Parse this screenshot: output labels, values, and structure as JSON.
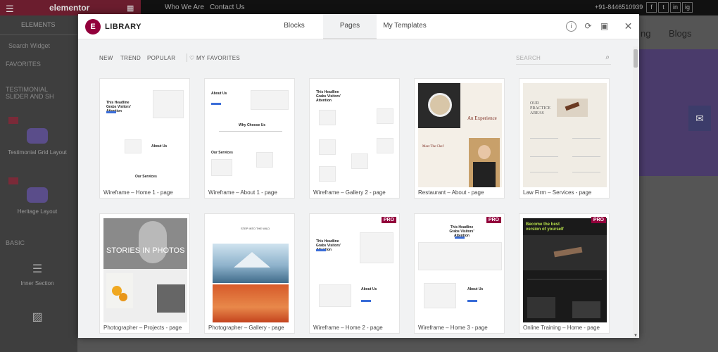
{
  "background": {
    "brand": "elementor",
    "top_links": [
      "Who We Are",
      "Contact Us"
    ],
    "phone": "+91-8446510939",
    "social": [
      "f",
      "t",
      "in",
      "ig"
    ],
    "sidebar_tab": "ELEMENTS",
    "sidebar_search": "Search Widget",
    "sidebar_sections": [
      "FAVORITES",
      "TESTIMONIAL SLIDER AND SH",
      "BASIC"
    ],
    "widgets": [
      "Testimonial Grid Layout",
      "Heritage Layout",
      "Inner Section"
    ],
    "nav": [
      "ng",
      "Blogs"
    ]
  },
  "modal": {
    "title": "LIBRARY",
    "logo": "E",
    "tabs": [
      "Blocks",
      "Pages",
      "My Templates"
    ],
    "active_tab": "Pages",
    "filters": [
      "NEW",
      "TREND",
      "POPULAR"
    ],
    "favorites": "MY FAVORITES",
    "search_placeholder": "SEARCH",
    "accent": "#92003b"
  },
  "cards": [
    {
      "label": "Wireframe – Home 1 - page",
      "pro": false
    },
    {
      "label": "Wireframe – About 1 - page",
      "pro": false
    },
    {
      "label": "Wireframe – Gallery 2 - page",
      "pro": false
    },
    {
      "label": "Restaurant – About - page",
      "pro": false
    },
    {
      "label": "Law Firm – Services - page",
      "pro": false
    },
    {
      "label": "Photographer – Projects - page",
      "pro": false
    },
    {
      "label": "Photographer – Gallery - page",
      "pro": false
    },
    {
      "label": "Wireframe – Home 2 - page",
      "pro": true
    },
    {
      "label": "Wireframe – Home 3 - page",
      "pro": true
    },
    {
      "label": "Online Training – Home - page",
      "pro": true
    }
  ],
  "thumb_text": {
    "headline": "This Headline Grabs Visitors' Attention",
    "about": "About Us",
    "services": "Our Services",
    "why": "Why Choose Us",
    "experience": "An Experience",
    "chef": "Meet The Chef",
    "practice": "OUR PRACTICE AREAS",
    "stories": "STORIES IN PHOTOS",
    "wild": "STEP INTO THE WILD",
    "training": "Become the best version of yourself",
    "pro_badge": "PRO"
  }
}
